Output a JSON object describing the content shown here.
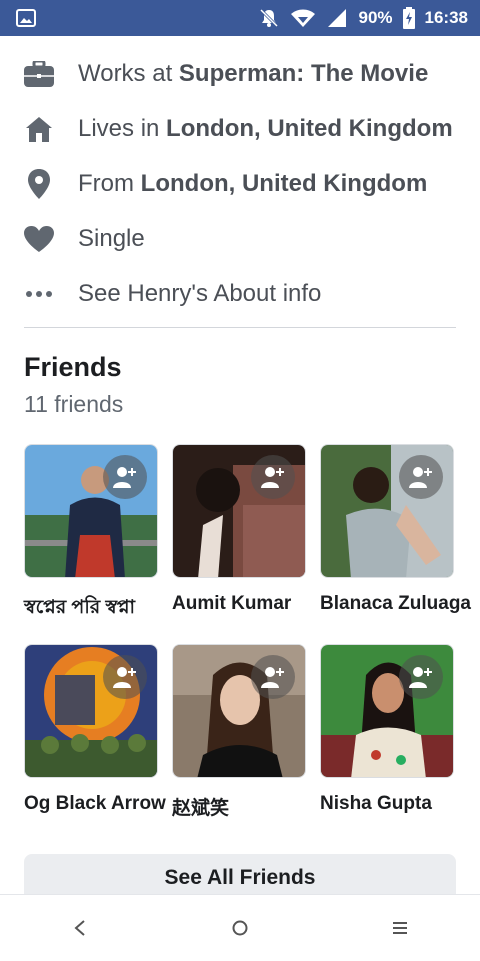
{
  "status_bar": {
    "battery": "90%",
    "time": "16:38",
    "icons": [
      "gallery-icon",
      "mute-icon",
      "wifi-icon",
      "signal-icon",
      "battery-icon"
    ]
  },
  "intro": [
    {
      "icon": "briefcase-icon",
      "prefix": "Works at ",
      "bold": "Superman: The Movie"
    },
    {
      "icon": "home-icon",
      "prefix": "Lives in ",
      "bold": "London, United Kingdom"
    },
    {
      "icon": "location-pin-icon",
      "prefix": "From ",
      "bold": "London, United Kingdom"
    },
    {
      "icon": "heart-icon",
      "prefix": "Single",
      "bold": ""
    },
    {
      "icon": "more-dots-icon",
      "prefix": "See Henry's About info",
      "bold": ""
    }
  ],
  "friends": {
    "title": "Friends",
    "count": "11 friends",
    "items": [
      {
        "name": "স্বপ্নের পরি স্বপ্না",
        "colors": [
          "#5aa0d8",
          "#3a6b3a",
          "#c0392b"
        ]
      },
      {
        "name": "Aumit Kumar",
        "colors": [
          "#2b1d18",
          "#8a5a44",
          "#6b4a3a"
        ]
      },
      {
        "name": "Blanaca Zuluaga",
        "colors": [
          "#4a6b3d",
          "#a7b3b8",
          "#c9a58e"
        ]
      },
      {
        "name": "Og Black Arrow",
        "colors": [
          "#3a4a8a",
          "#e67e22",
          "#3d5a2f"
        ]
      },
      {
        "name": "赵斌笑",
        "colors": [
          "#8a7a6a",
          "#d9b8a0",
          "#1a1a1a"
        ]
      },
      {
        "name": "Nisha Gupta",
        "colors": [
          "#3d8a3d",
          "#e8e0d0",
          "#5a3a2a"
        ]
      }
    ],
    "see_all_label": "See All Friends"
  },
  "nav": {
    "icons": [
      "back-icon",
      "home-circle-icon",
      "recents-icon"
    ]
  },
  "colors": {
    "status_bar": "#3b5998",
    "icon_gray": "#606770",
    "text_gray": "#4b4f56"
  }
}
